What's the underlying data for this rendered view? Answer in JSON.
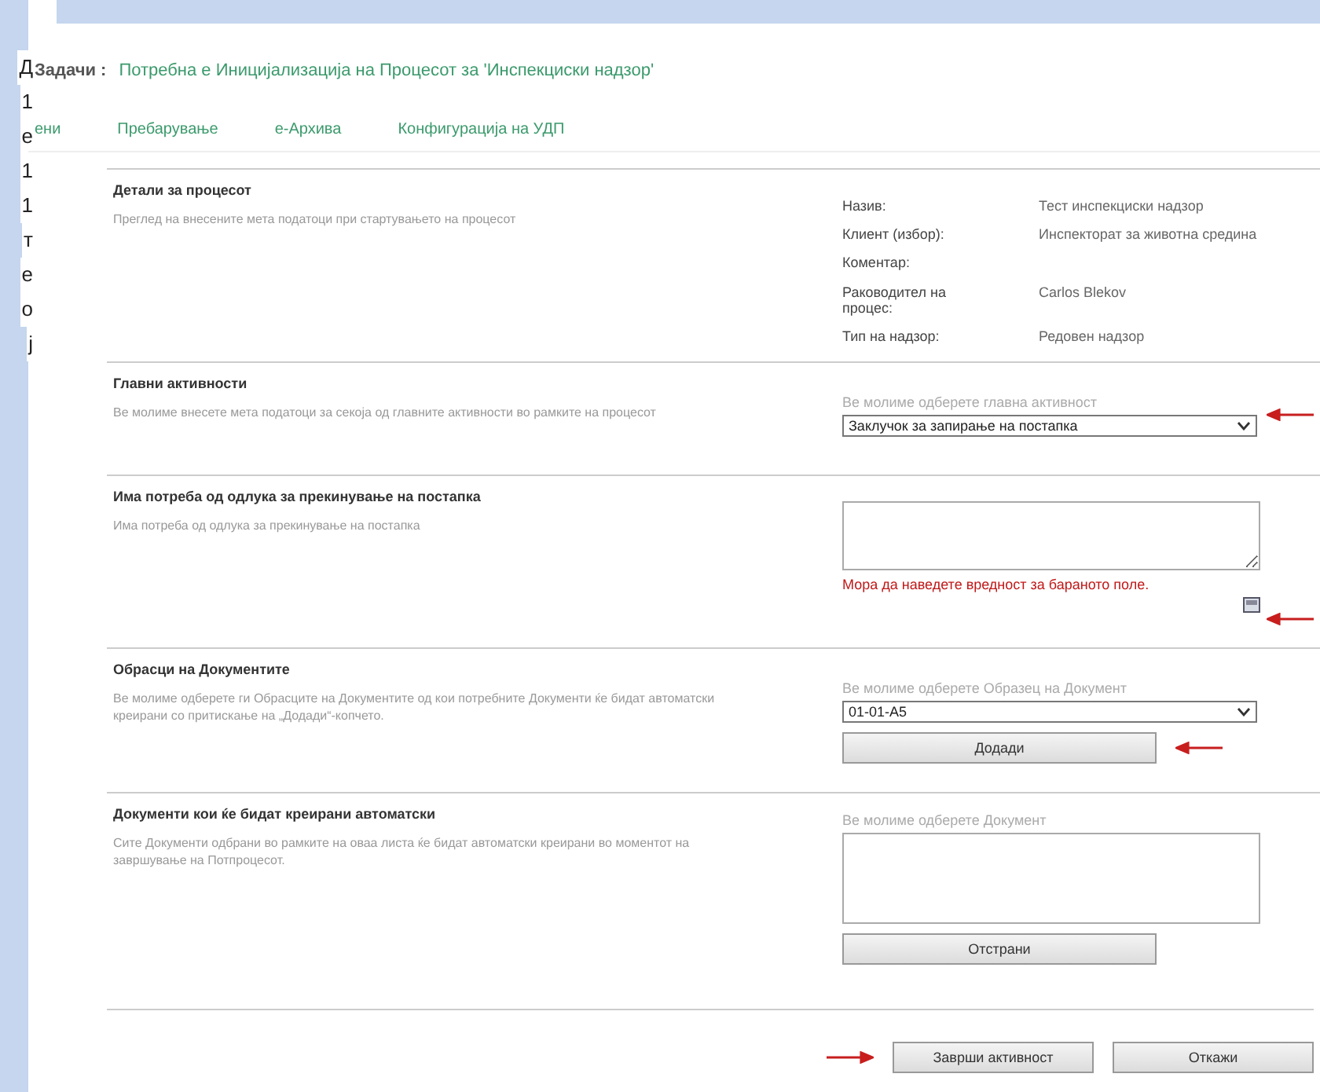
{
  "sidebar_fragments": [
    "Д",
    "1",
    "е",
    "1",
    "1",
    "т",
    "е",
    "о",
    "ј"
  ],
  "header": {
    "label": "Задачи :",
    "title": "Потребна е Иницијализација на Процесот за 'Инспекциски надзор'"
  },
  "nav": [
    {
      "label": "ени"
    },
    {
      "label": "Пребарување"
    },
    {
      "label": "е-Архива"
    },
    {
      "label": "Конфигурација на УДП"
    }
  ],
  "sections": [
    {
      "kind": "details",
      "title": "Детали за процесот",
      "description": "Преглед на внесените мета податоци при стартувањето на процесот",
      "fields": [
        {
          "label": "Назив:",
          "value": "Тест инспекциски надзор"
        },
        {
          "label": "Клиент (избор):",
          "value": "Инспекторат за животна средина"
        },
        {
          "label": "Коментар:"
        },
        {
          "label": "Раководител на процес:",
          "value": "Carlos Blekov"
        },
        {
          "label": "Тип на надзор:",
          "value": "Редовен надзор"
        }
      ]
    },
    {
      "kind": "select",
      "title": "Главни активности",
      "description": "Ве молиме внесете мета податоци за секоја од главните активности во рамките на процесот",
      "hint": "Ве молиме одберете главна активност",
      "value": "Заклучок за запирање на постапка",
      "annotated": true
    },
    {
      "kind": "textarea",
      "title": "Има потреба од одлука за прекинување на постапка",
      "description": "Има потреба од одлука за прекинување на постапка",
      "error": "Мора да наведете вредност за бараното поле.",
      "annotated": true
    },
    {
      "kind": "select",
      "title": "Обрасци на Документите",
      "description": "Ве молиме одберете ги Обрасците на Документите од кои потребните Документи ќе бидат автоматски креирани со притискање на „Додади“-копчето.",
      "hint": "Ве молиме одберете Образец на Документ",
      "value": "01-01-А5",
      "button": {
        "label": "Додади",
        "annotated": true
      },
      "annotated": false
    },
    {
      "kind": "list",
      "title": "Документи кои ќе бидат креирани автоматски",
      "description": "Сите Документи одбрани во рамките на оваа листа ќе бидат автоматски креирани во моментот на завршување на Потпроцесот.",
      "hint": "Ве молиме одберете Документ",
      "button": {
        "label": "Отстрани",
        "annotated": false
      }
    }
  ],
  "actions": [
    {
      "label": "Заврши активност",
      "annotated": true
    },
    {
      "label": "Откажи",
      "annotated": false
    }
  ]
}
